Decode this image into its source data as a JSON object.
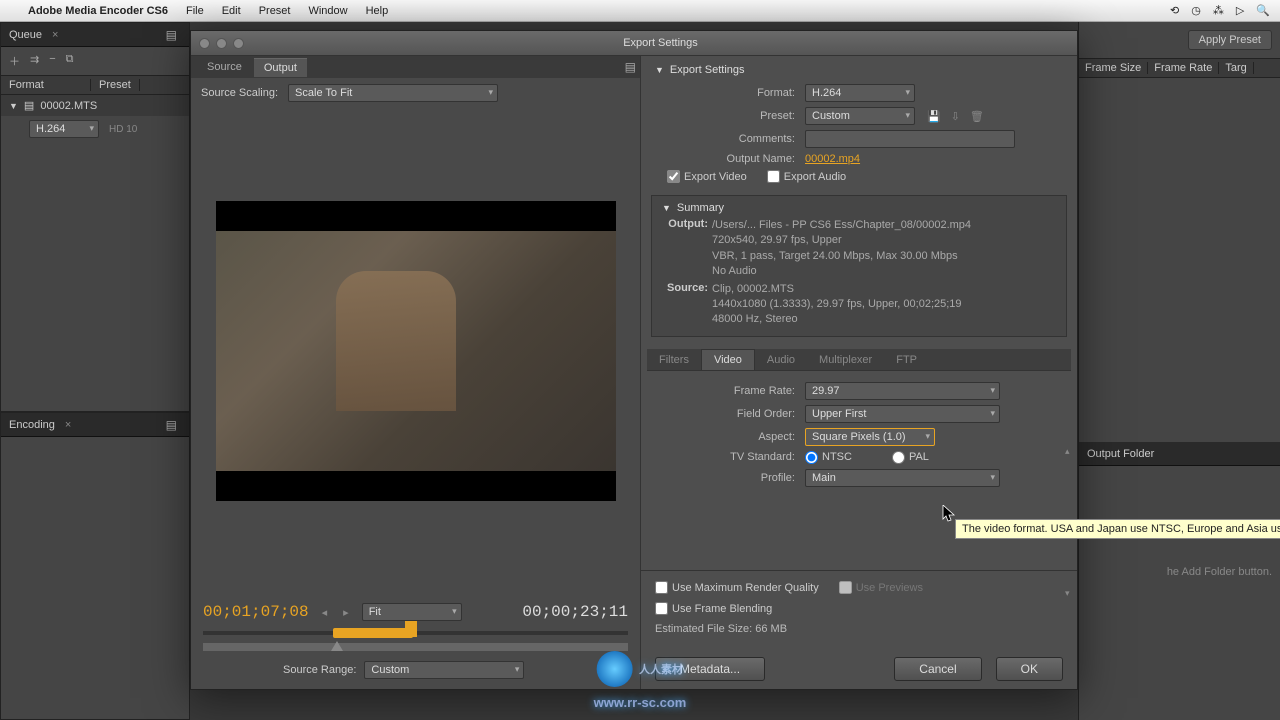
{
  "menubar": {
    "app": "Adobe Media Encoder CS6",
    "items": [
      "File",
      "Edit",
      "Preset",
      "Window",
      "Help"
    ]
  },
  "queue": {
    "title": "Queue",
    "cols": {
      "format": "Format",
      "preset": "Preset"
    },
    "row_file": "00002.MTS",
    "row_format": "H.264",
    "row_out": "HD 10"
  },
  "encoding": {
    "title": "Encoding"
  },
  "right_back": {
    "apply": "Apply Preset",
    "cols": [
      "Frame Size",
      "Frame Rate",
      "Targ"
    ],
    "output_folder": "Output Folder",
    "hint": "he Add Folder button."
  },
  "modal": {
    "title": "Export Settings",
    "left": {
      "tab_source": "Source",
      "tab_output": "Output",
      "scaling_label": "Source Scaling:",
      "scaling_val": "Scale To Fit",
      "tc_current": "00;01;07;08",
      "tc_total": "00;00;23;11",
      "fit": "Fit",
      "range_label": "Source Range:",
      "range_val": "Custom"
    },
    "export": {
      "title": "Export Settings",
      "format_label": "Format:",
      "format_val": "H.264",
      "preset_label": "Preset:",
      "preset_val": "Custom",
      "comments_label": "Comments:",
      "output_name_label": "Output Name:",
      "output_name_val": "00002.mp4",
      "export_video": "Export Video",
      "export_audio": "Export Audio"
    },
    "summary": {
      "title": "Summary",
      "output_k": "Output:",
      "output_v": "/Users/... Files - PP CS6 Ess/Chapter_08/00002.mp4\n720x540, 29.97 fps, Upper\nVBR, 1 pass, Target 24.00 Mbps, Max 30.00 Mbps\nNo Audio",
      "source_k": "Source:",
      "source_v": "Clip, 00002.MTS\n1440x1080 (1.3333), 29.97 fps, Upper, 00;02;25;19\n48000 Hz, Stereo"
    },
    "subtabs": [
      "Filters",
      "Video",
      "Audio",
      "Multiplexer",
      "FTP"
    ],
    "video": {
      "frame_rate_label": "Frame Rate:",
      "frame_rate_val": "29.97",
      "field_order_label": "Field Order:",
      "field_order_val": "Upper First",
      "aspect_label": "Aspect:",
      "aspect_val": "Square Pixels (1.0)",
      "tv_label": "TV Standard:",
      "tv_ntsc": "NTSC",
      "tv_pal": "PAL",
      "profile_label": "Profile:",
      "profile_val": "Main"
    },
    "bottom": {
      "max_quality": "Use Maximum Render Quality",
      "use_previews": "Use Previews",
      "frame_blend": "Use Frame Blending",
      "est_label": "Estimated File Size:",
      "est_val": "66 MB",
      "metadata": "Metadata...",
      "cancel": "Cancel",
      "ok": "OK"
    }
  },
  "tooltip": "The video format. USA and Japan use NTSC, Europe and Asia use PAL.",
  "watermark": {
    "text": "人人素材",
    "url": "www.rr-sc.com"
  }
}
